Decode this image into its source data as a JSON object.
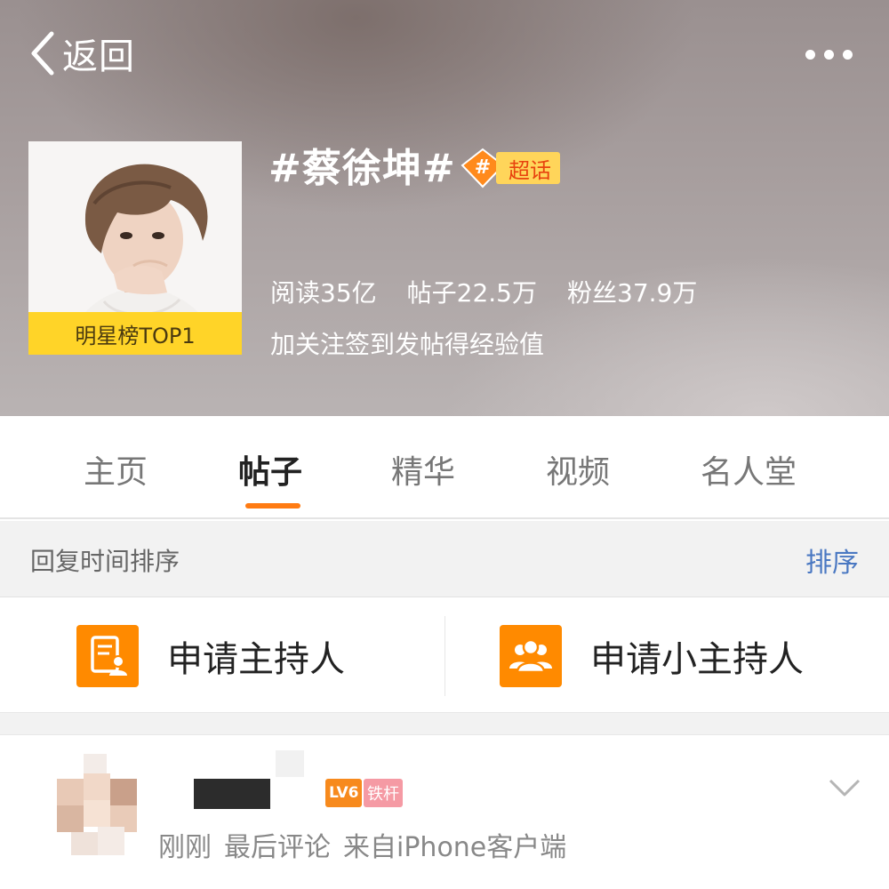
{
  "header": {
    "back_label": "返回",
    "more_icon": "more-dots-icon",
    "topic_title": "#蔡徐坤#",
    "super_badge": "超话",
    "rank_label": "明星榜TOP1",
    "stats": {
      "reads": "阅读35亿",
      "posts": "帖子22.5万",
      "fans": "粉丝37.9万"
    },
    "tip": "加关注签到发帖得经验值"
  },
  "tabs": [
    {
      "label": "主页",
      "active": false
    },
    {
      "label": "帖子",
      "active": true
    },
    {
      "label": "精华",
      "active": false
    },
    {
      "label": "视频",
      "active": false
    },
    {
      "label": "名人堂",
      "active": false
    }
  ],
  "sortbar": {
    "label": "回复时间排序",
    "action": "排序"
  },
  "apply": {
    "host": {
      "label": "申请主持人",
      "icon": "document-user-icon"
    },
    "assistant": {
      "label": "申请小主持人",
      "icon": "group-icon"
    }
  },
  "post": {
    "level_badge": "LV6",
    "role_badge": "铁杆",
    "meta_time": "刚刚",
    "meta_action": "最后评论",
    "meta_source": "来自iPhone客户端"
  },
  "colors": {
    "accent_orange": "#ff7b12",
    "rank_yellow": "#ffd428",
    "link_blue": "#4a78c2",
    "icon_orange": "#ff8a00"
  }
}
